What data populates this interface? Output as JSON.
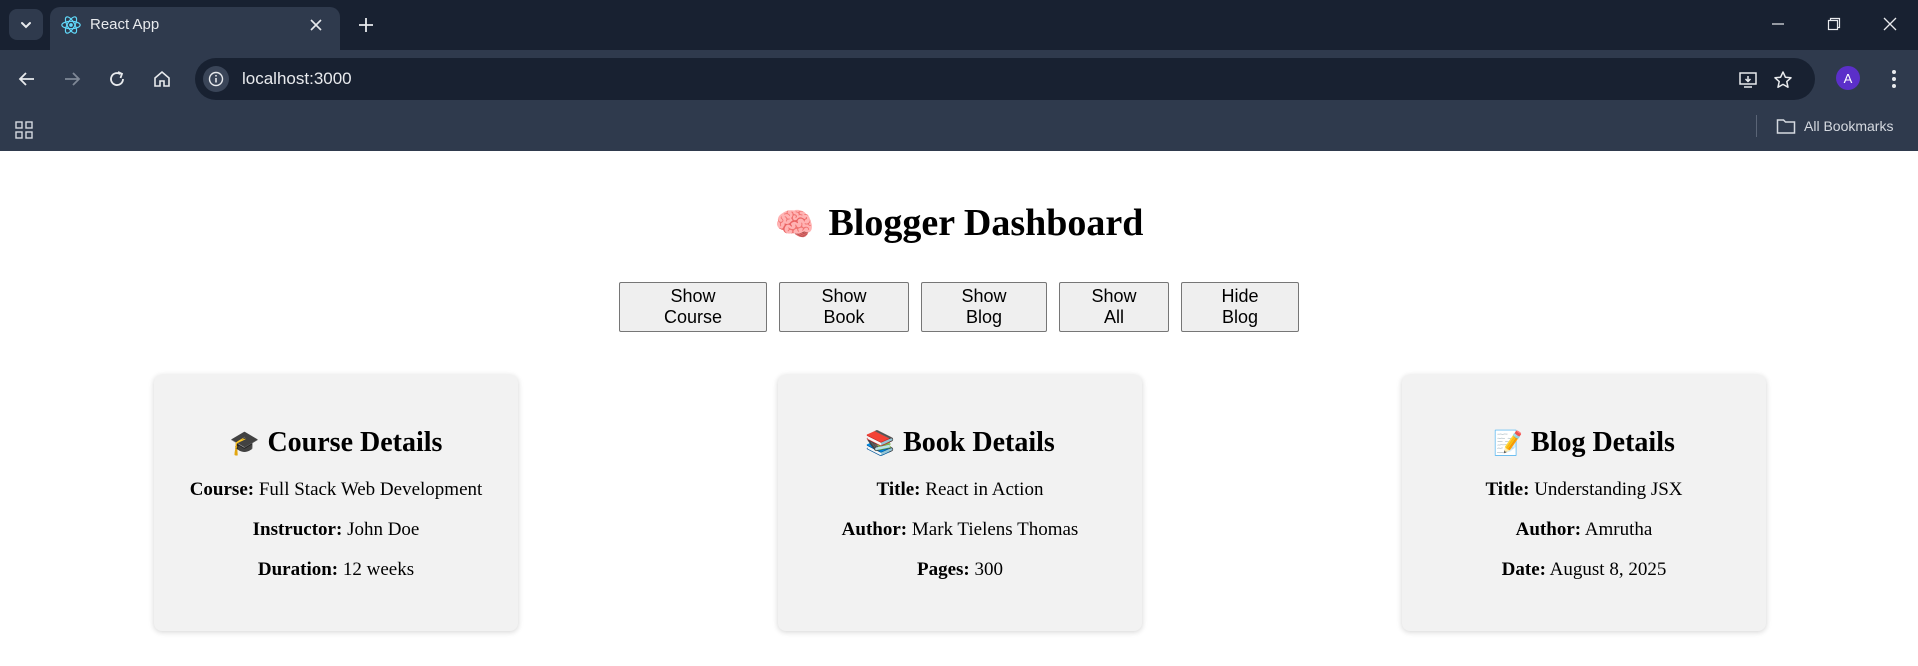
{
  "browser": {
    "tab_title": "React App",
    "url": "localhost:3000",
    "avatar_letter": "A",
    "bookmarks_label": "All Bookmarks"
  },
  "page": {
    "heading_emoji": "🧠",
    "heading": "Blogger Dashboard",
    "buttons": [
      {
        "label": "Show Course"
      },
      {
        "label": "Show Book"
      },
      {
        "label": "Show Blog"
      },
      {
        "label": "Show All"
      },
      {
        "label": "Hide Blog"
      }
    ],
    "cards": [
      {
        "emoji": "🎓",
        "title": "Course Details",
        "fields": [
          {
            "label": "Course:",
            "value": "Full Stack Web Development"
          },
          {
            "label": "Instructor:",
            "value": "John Doe"
          },
          {
            "label": "Duration:",
            "value": "12 weeks"
          }
        ]
      },
      {
        "emoji": "📚",
        "title": "Book Details",
        "fields": [
          {
            "label": "Title:",
            "value": "React in Action"
          },
          {
            "label": "Author:",
            "value": "Mark Tielens Thomas"
          },
          {
            "label": "Pages:",
            "value": "300"
          }
        ]
      },
      {
        "emoji": "📝",
        "title": "Blog Details",
        "fields": [
          {
            "label": "Title:",
            "value": "Understanding JSX"
          },
          {
            "label": "Author:",
            "value": "Amrutha"
          },
          {
            "label": "Date:",
            "value": "August 8, 2025"
          }
        ]
      }
    ]
  }
}
